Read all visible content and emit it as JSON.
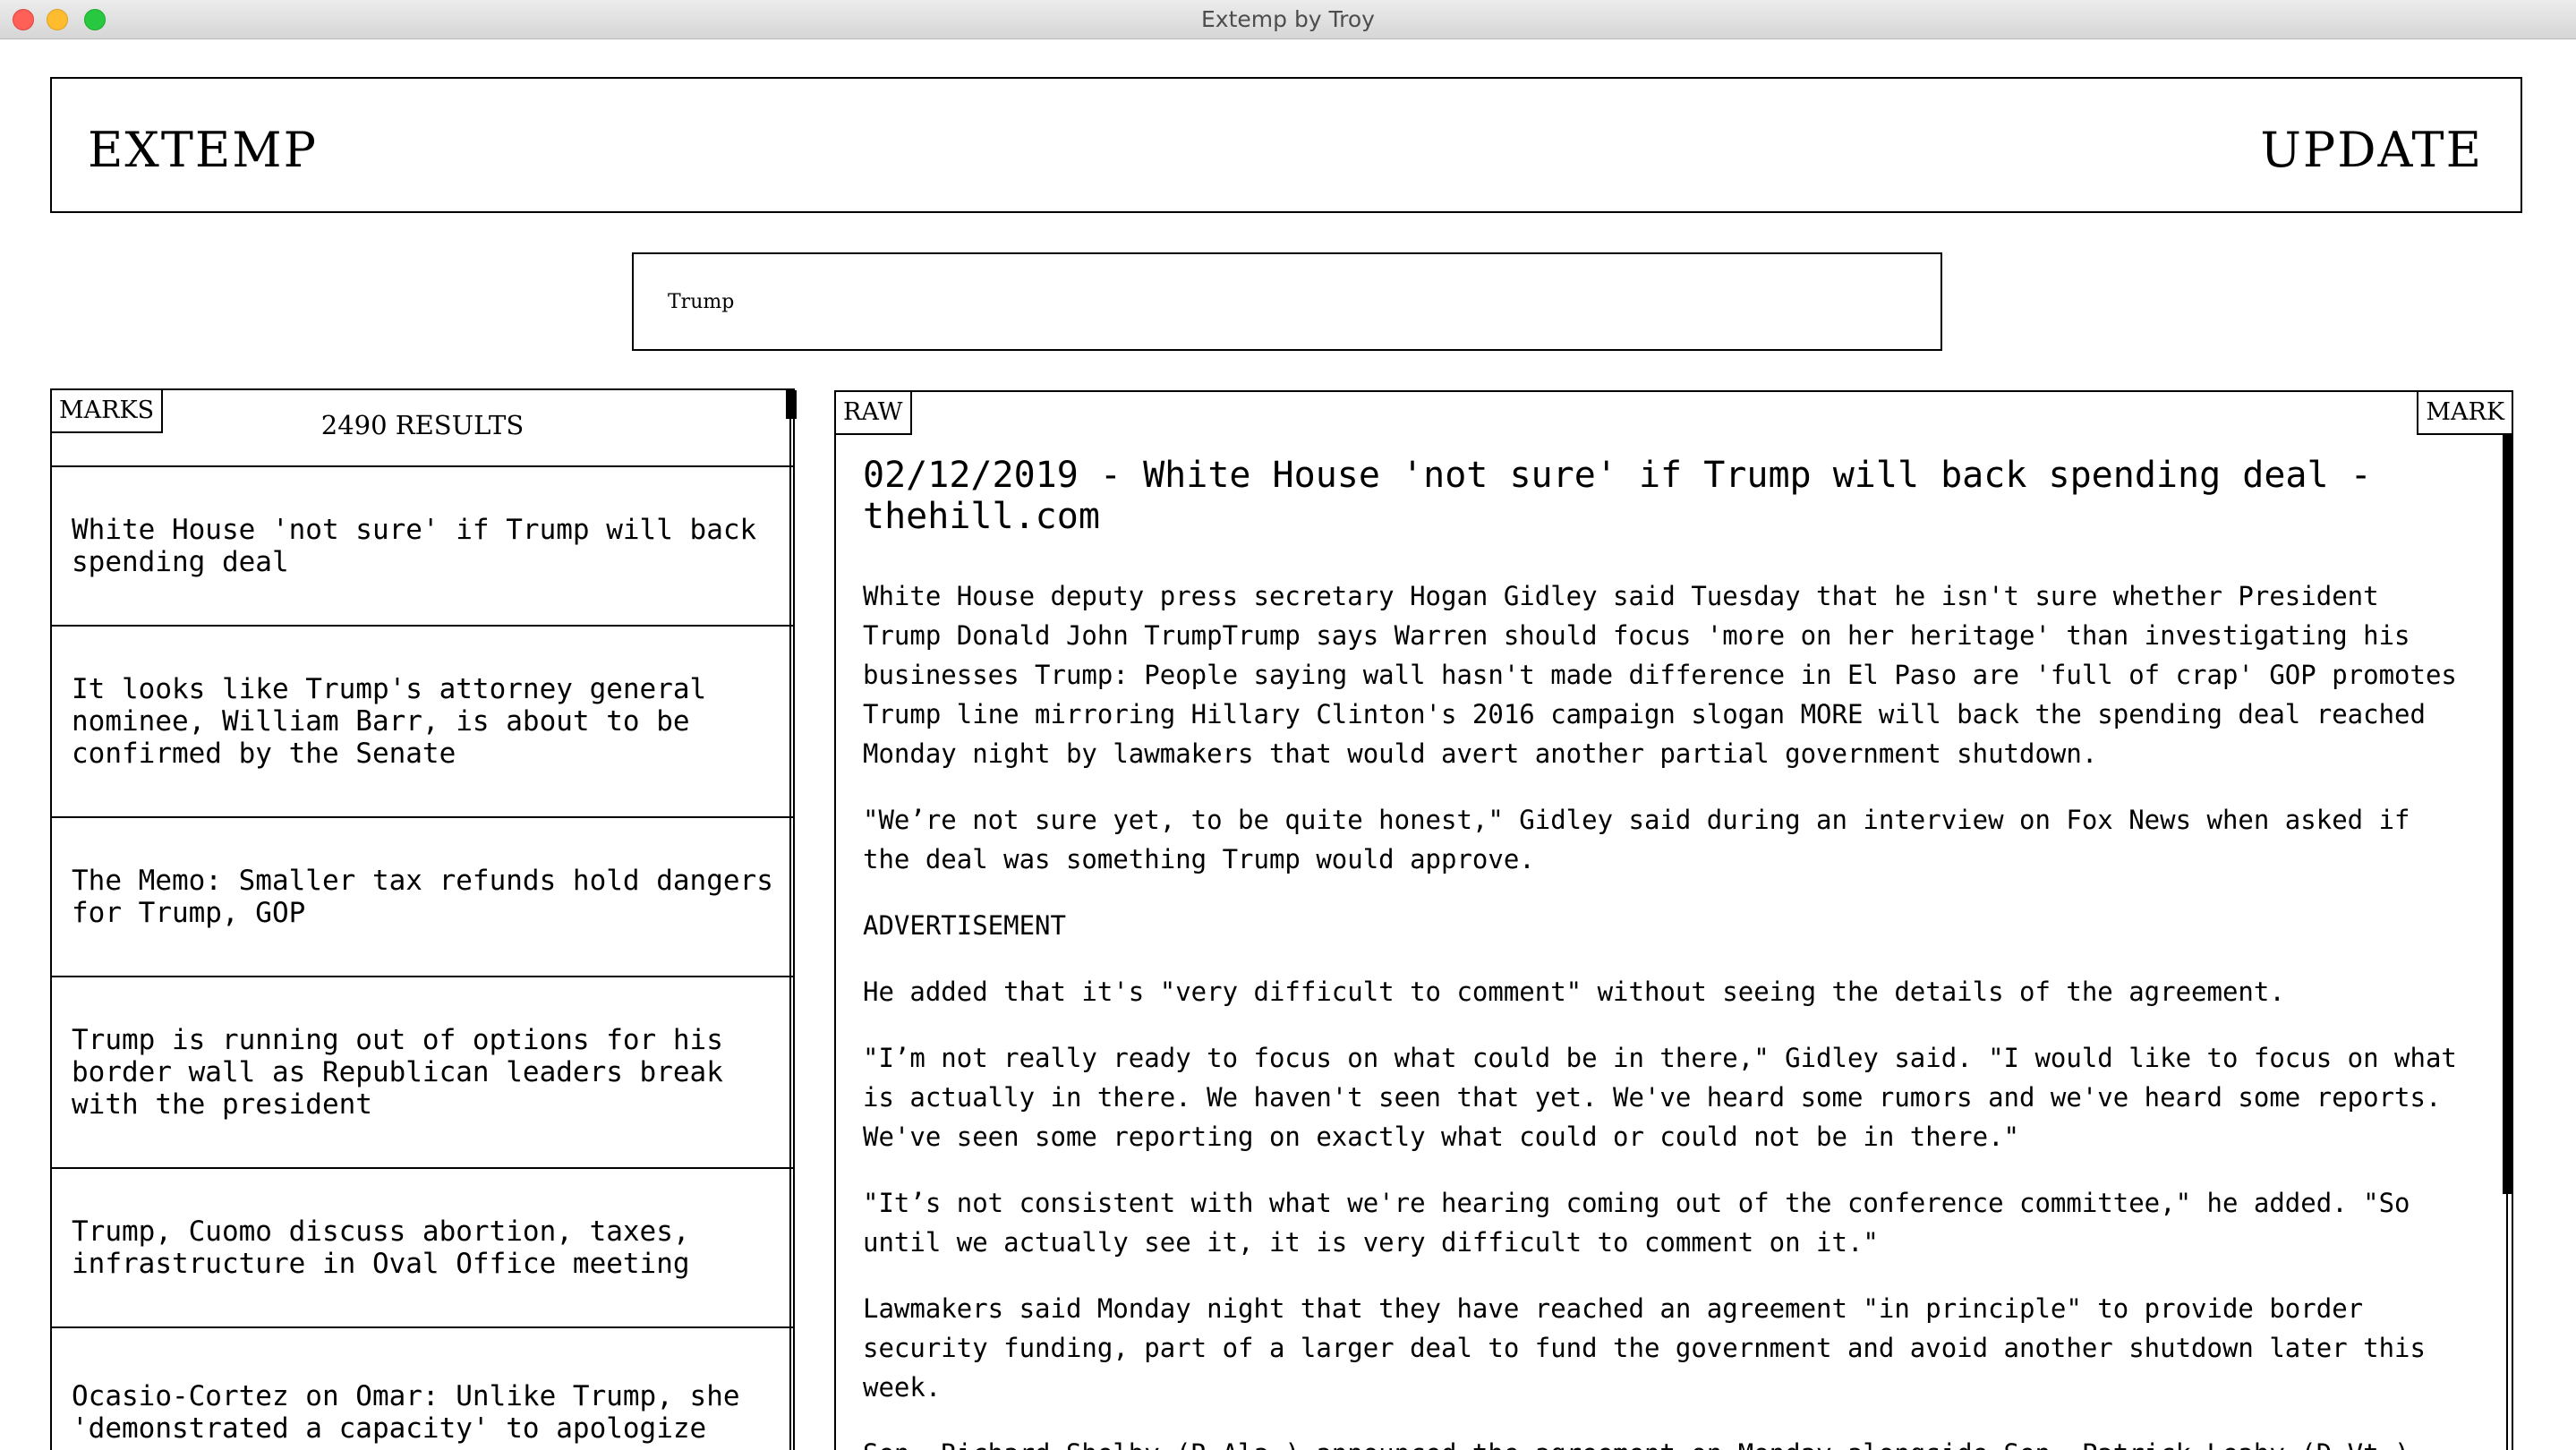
{
  "window": {
    "title": "Extemp by Troy"
  },
  "header": {
    "title": "EXTEMP",
    "update_label": "UPDATE"
  },
  "search": {
    "value": "Trump"
  },
  "left_panel": {
    "tab_label": "MARKS",
    "results_count": "2490 RESULTS",
    "results": [
      {
        "title": "White House 'not sure' if Trump will back spending deal"
      },
      {
        "title": "It looks like Trump's attorney general nominee, William Barr, is about to be confirmed by the Senate"
      },
      {
        "title": "The Memo: Smaller tax refunds hold dangers for Trump, GOP"
      },
      {
        "title": "Trump is running out of options for his border wall as Republican leaders break with the president"
      },
      {
        "title": "Trump, Cuomo discuss abortion, taxes, infrastructure in Oval Office meeting"
      },
      {
        "title": "Ocasio-Cortez on Omar: Unlike Trump, she 'demonstrated a capacity' to apologize"
      }
    ]
  },
  "article_panel": {
    "raw_label": "RAW",
    "mark_label": "MARK",
    "title": "02/12/2019 - White House 'not sure' if Trump will back spending deal - thehill.com",
    "paragraphs": [
      "White House deputy press secretary Hogan Gidley said Tuesday that he isn't sure whether President Trump Donald John TrumpTrump says Warren should focus 'more on her heritage' than investigating his businesses Trump: People saying wall hasn't made difference in El Paso are 'full of crap' GOP promotes Trump line mirroring Hillary Clinton's 2016 campaign slogan MORE will back the spending deal reached Monday night by lawmakers that would avert another partial government shutdown.",
      "\"We’re not sure yet, to be quite honest,\" Gidley said during an interview on Fox News when asked if the deal was something Trump would approve.",
      "ADVERTISEMENT",
      "He added that it's \"very difficult to comment\" without seeing the details of the agreement.",
      "\"I’m not really ready to focus on what could be in there,\" Gidley said. \"I would like to focus on what is actually in there. We haven't seen that yet. We've heard some rumors and we've heard some reports. We've seen some reporting on exactly what could or could not be in there.\"",
      "\"It’s not consistent with what we're hearing coming out of the conference committee,\" he added. \"So until we actually see it, it is very difficult to comment on it.\"",
      "Lawmakers said Monday night that they have reached an agreement \"in principle\" to provide border security funding, part of a larger deal to fund the government and avoid another shutdown later this week.",
      "Sen. Richard Shelby (R-Ala.) announced the agreement on Monday alongside Sen. Patrick Leahy (D-Vt.)"
    ]
  }
}
